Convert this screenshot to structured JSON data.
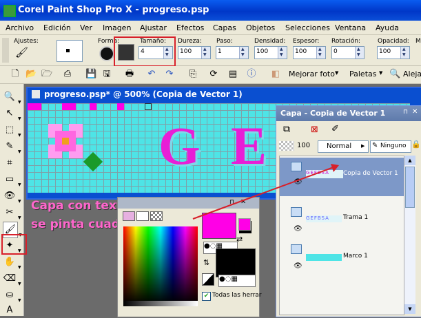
{
  "window": {
    "title": "Corel Paint Shop Pro X - progreso.psp"
  },
  "menu": [
    "Archivo",
    "Edición",
    "Ver",
    "Imagen",
    "Ajustar",
    "Efectos",
    "Capas",
    "Objetos",
    "Selecciones",
    "Ventana",
    "Ayuda"
  ],
  "tool_options": {
    "presets_label": "Ajustes:",
    "shape_label": "Forma:",
    "size_label": "Tamaño:",
    "size_value": "4",
    "hardness_label": "Dureza:",
    "hardness_value": "100",
    "step_label": "Paso:",
    "step_value": "1",
    "density_label": "Densidad:",
    "density_value": "100",
    "thickness_label": "Espesor:",
    "thickness_value": "100",
    "rotation_label": "Rotación:",
    "rotation_value": "0",
    "opacity_label": "Opacidad:",
    "opacity_value": "100",
    "mode_label": "M"
  },
  "standard_toolbar": {
    "enhance_label": "Mejorar foto",
    "palettes_label": "Paletas",
    "align_label": "Aleja"
  },
  "image_window": {
    "title": "progreso.psp* @ 500% (Copia de Vector 1)",
    "canvas_letters": [
      "G",
      "E"
    ]
  },
  "annotation": {
    "line1": "Capa con texto rosa",
    "line2": "se pinta cuadros en rosa"
  },
  "materials": {
    "all_tools_label": "Todas las herrar"
  },
  "layers": {
    "title": "Capa - Copia de Vector 1",
    "opacity": "100",
    "blend_mode": "Normal",
    "mask_mode": "Ninguno",
    "items": [
      {
        "name": "Copia de Vector 1",
        "thumb_text": "GEFBSA"
      },
      {
        "name": "Trama 1",
        "thumb_text": "GEFBSA"
      },
      {
        "name": "Marco 1",
        "thumb_text": ""
      }
    ]
  },
  "colors": {
    "accent_pink": "#ff00e6",
    "canvas_cyan": "#4ee4e6",
    "highlight_red": "#d8202a",
    "title_blue": "#0037c8"
  }
}
